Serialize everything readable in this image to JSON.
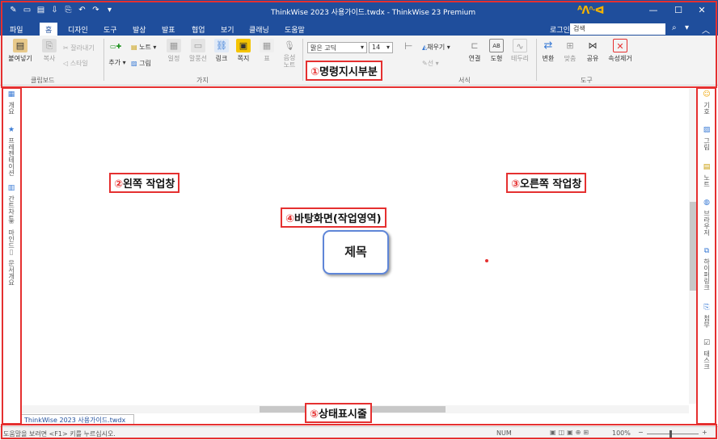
{
  "window": {
    "title": "ThinkWise 2023 사용가이드.twdx - ThinkWise 23 Premium",
    "brand_logo": "ᴬᐱᐢᐗ",
    "quick_access": [
      "✎",
      "▭",
      "▤",
      "⇩",
      "⎘",
      "↶",
      "↷",
      "▾"
    ],
    "controls": {
      "minimize": "—",
      "maximize": "☐",
      "close": "✕"
    }
  },
  "menu": {
    "items": [
      "파일",
      "홈",
      "디자인",
      "도구",
      "발상",
      "발표",
      "협업",
      "보기",
      "클래닝",
      "도움말"
    ],
    "active": "홈",
    "login": "로그인",
    "search_placeholder": "검색",
    "search_icon": "⌕",
    "help_icon": "▾",
    "collapse_icon": "︿"
  },
  "ribbon": {
    "clipboard": {
      "paste": "붙여넣기",
      "copy": "복사",
      "cut": "잘라내기",
      "style": "스타일",
      "group": "클립보드"
    },
    "branch": {
      "add": "추가",
      "note": "노트",
      "picture": "그림",
      "schedule": "일정",
      "callout": "말풍선",
      "link": "링크",
      "memo": "쪽지",
      "table": "표",
      "voice_note": "음성\n노트",
      "group": "가지"
    },
    "format": {
      "font": "맑은 고딕",
      "size": "14",
      "fill": "채우기",
      "line": "선",
      "connect": "연결",
      "shape": "도형",
      "border": "테두리",
      "group": "서식"
    },
    "tools": {
      "convert": "변환",
      "fit": "맞춤",
      "share": "공유",
      "remove_attr": "속성제거",
      "group": "도구"
    }
  },
  "annotations": {
    "command": {
      "num": "①",
      "text": "명령지시부분"
    },
    "left_pane": {
      "num": "②",
      "text": "왼쪽 작업창"
    },
    "right_pane": {
      "num": "③",
      "text": "오른쪽 작업창"
    },
    "desktop": {
      "num": "④",
      "text": "바탕화면(작업영역)"
    },
    "status": {
      "num": "⑤",
      "text": "상태표시줄"
    }
  },
  "left_pane": [
    {
      "icon": "outline-icon",
      "glyph": "▦",
      "label": "개요"
    },
    {
      "icon": "star-icon",
      "glyph": "★",
      "label": "프레젠테이션"
    },
    {
      "icon": "gantt-icon",
      "glyph": "▥",
      "label": "간트차트"
    },
    {
      "icon": "mindmap-icon",
      "glyph": "❀",
      "label": "마인드"
    },
    {
      "icon": "doc-icon",
      "glyph": "▯",
      "label": "문서개요"
    }
  ],
  "right_pane": [
    {
      "icon": "smiley-icon",
      "glyph": "☺",
      "label": "기호"
    },
    {
      "icon": "picture-icon",
      "glyph": "▨",
      "label": "그림"
    },
    {
      "icon": "note-icon",
      "glyph": "▤",
      "label": "노트"
    },
    {
      "icon": "globe-icon",
      "glyph": "◍",
      "label": "브라우저"
    },
    {
      "icon": "hyperlink-icon",
      "glyph": "⧉",
      "label": "하이퍼링크"
    },
    {
      "icon": "attach-icon",
      "glyph": "⎘",
      "label": "첨부"
    },
    {
      "icon": "task-icon",
      "glyph": "☑",
      "label": "태스크"
    }
  ],
  "canvas": {
    "central_topic": "제목"
  },
  "doc_tab": {
    "name": "ThinkWise 2023 사용가이드.twdx",
    "close": "✕"
  },
  "status": {
    "hint": "도움말을 보려면 <F1> 키를 누르십시오.",
    "num": "NUM",
    "zoom": "100%"
  },
  "colors": {
    "titlebar": "#1f4e9c",
    "annotation": "#e53030",
    "topic_border": "#5f86d8"
  }
}
